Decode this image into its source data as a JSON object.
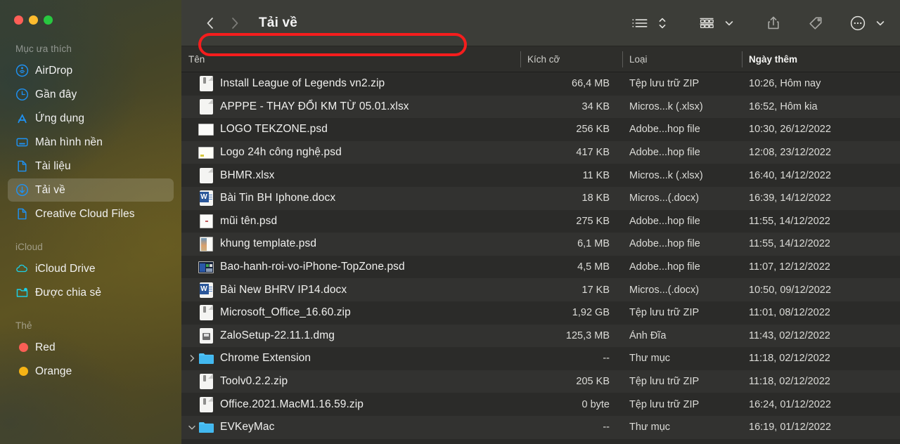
{
  "window": {
    "traffic_lights": [
      {
        "name": "close",
        "color": "#ff5f57"
      },
      {
        "name": "minimize",
        "color": "#febc2e"
      },
      {
        "name": "zoom",
        "color": "#28c840"
      }
    ]
  },
  "toolbar": {
    "back_label": "Quay lại",
    "forward_label": "Tiến tới",
    "title": "Tải về",
    "view_list_label": "Dạng danh sách",
    "sort_label": "Sắp xếp",
    "group_label": "Nhóm",
    "group_chevron": "Tùy chọn nhóm",
    "share_label": "Chia sẻ",
    "tag_label": "Thẻ",
    "more_label": "Thêm",
    "more_chevron": "Tùy chọn thêm"
  },
  "sidebar": {
    "sections": [
      {
        "title": "Mục ưa thích",
        "items": [
          {
            "label": "AirDrop",
            "icon": "airdrop-icon",
            "selected": false
          },
          {
            "label": "Gần đây",
            "icon": "clock-icon",
            "selected": false
          },
          {
            "label": "Ứng dụng",
            "icon": "applications-icon",
            "selected": false
          },
          {
            "label": "Màn hình nền",
            "icon": "desktop-icon",
            "selected": false
          },
          {
            "label": "Tài liệu",
            "icon": "document-icon",
            "selected": false
          },
          {
            "label": "Tải về",
            "icon": "downloads-icon",
            "selected": true
          },
          {
            "label": "Creative Cloud Files",
            "icon": "document-icon",
            "selected": false
          }
        ]
      },
      {
        "title": "iCloud",
        "items": [
          {
            "label": "iCloud Drive",
            "icon": "cloud-icon",
            "selected": false
          },
          {
            "label": "Được chia sẻ",
            "icon": "shared-folder-icon",
            "selected": false
          }
        ]
      },
      {
        "title": "Thẻ",
        "items": [
          {
            "label": "Red",
            "icon": "tag-dot-icon",
            "color": "#fa5f55",
            "selected": false
          },
          {
            "label": "Orange",
            "icon": "tag-dot-icon",
            "color": "#f5b315",
            "selected": false
          }
        ]
      }
    ]
  },
  "columns": [
    {
      "key": "name",
      "label": "Tên",
      "sorted": false
    },
    {
      "key": "size",
      "label": "Kích cỡ",
      "sorted": false
    },
    {
      "key": "kind",
      "label": "Loại",
      "sorted": false
    },
    {
      "key": "date",
      "label": "Ngày thêm",
      "sorted": true
    }
  ],
  "files": [
    {
      "name": "Install League of Legends vn2.zip",
      "size": "66,4 MB",
      "kind": "Tệp lưu trữ ZIP",
      "date": "10:26, Hôm nay",
      "icon": "zip-icon",
      "twisty": "",
      "annotated": true
    },
    {
      "name": "APPPE - THAY ĐỔI KM TỪ 05.01.xlsx",
      "size": "34 KB",
      "kind": "Micros...k (.xlsx)",
      "date": "16:52, Hôm kia",
      "icon": "generic-doc-icon",
      "twisty": ""
    },
    {
      "name": "LOGO TEKZONE.psd",
      "size": "256 KB",
      "kind": "Adobe...hop file",
      "date": "10:30, 26/12/2022",
      "icon": "psd-white-icon",
      "twisty": ""
    },
    {
      "name": "Logo 24h công nghệ.psd",
      "size": "417 KB",
      "kind": "Adobe...hop file",
      "date": "12:08, 23/12/2022",
      "icon": "psd-white-icon",
      "twisty": ""
    },
    {
      "name": "BHMR.xlsx",
      "size": "11 KB",
      "kind": "Micros...k (.xlsx)",
      "date": "16:40, 14/12/2022",
      "icon": "generic-doc-icon",
      "twisty": ""
    },
    {
      "name": "Bài Tin BH Iphone.docx",
      "size": "18 KB",
      "kind": "Micros...(.docx)",
      "date": "16:39, 14/12/2022",
      "icon": "word-doc-icon",
      "twisty": ""
    },
    {
      "name": "mũi tên.psd",
      "size": "275 KB",
      "kind": "Adobe...hop file",
      "date": "11:55, 14/12/2022",
      "icon": "psd-dot-icon",
      "twisty": ""
    },
    {
      "name": "khung template.psd",
      "size": "6,1 MB",
      "kind": "Adobe...hop file",
      "date": "11:55, 14/12/2022",
      "icon": "psd-image-icon",
      "twisty": ""
    },
    {
      "name": "Bao-hanh-roi-vo-iPhone-TopZone.psd",
      "size": "4,5 MB",
      "kind": "Adobe...hop file",
      "date": "11:07, 12/12/2022",
      "icon": "psd-dark-icon",
      "twisty": ""
    },
    {
      "name": "Bài New BHRV IP14.docx",
      "size": "17 KB",
      "kind": "Micros...(.docx)",
      "date": "10:50, 09/12/2022",
      "icon": "word-doc-icon",
      "twisty": ""
    },
    {
      "name": "Microsoft_Office_16.60.zip",
      "size": "1,92 GB",
      "kind": "Tệp lưu trữ ZIP",
      "date": "11:01, 08/12/2022",
      "icon": "zip-icon",
      "twisty": ""
    },
    {
      "name": "ZaloSetup-22.11.1.dmg",
      "size": "125,3 MB",
      "kind": "Ảnh Đĩa",
      "date": "11:43, 02/12/2022",
      "icon": "dmg-icon",
      "twisty": ""
    },
    {
      "name": "Chrome Extension",
      "size": "--",
      "kind": "Thư mục",
      "date": "11:18, 02/12/2022",
      "icon": "folder-icon",
      "twisty": "collapsed"
    },
    {
      "name": "Toolv0.2.2.zip",
      "size": "205 KB",
      "kind": "Tệp lưu trữ ZIP",
      "date": "11:18, 02/12/2022",
      "icon": "zip-icon",
      "twisty": ""
    },
    {
      "name": "Office.2021.MacM1.16.59.zip",
      "size": "0 byte",
      "kind": "Tệp lưu trữ ZIP",
      "date": "16:24, 01/12/2022",
      "icon": "zip-icon",
      "twisty": ""
    },
    {
      "name": "EVKeyMac",
      "size": "--",
      "kind": "Thư mục",
      "date": "16:19, 01/12/2022",
      "icon": "folder-icon",
      "twisty": "expanded"
    }
  ],
  "annotation": {
    "type": "highlight-rectangle",
    "color": "#f51d1d",
    "target": "Install League of Legends vn2.zip"
  }
}
